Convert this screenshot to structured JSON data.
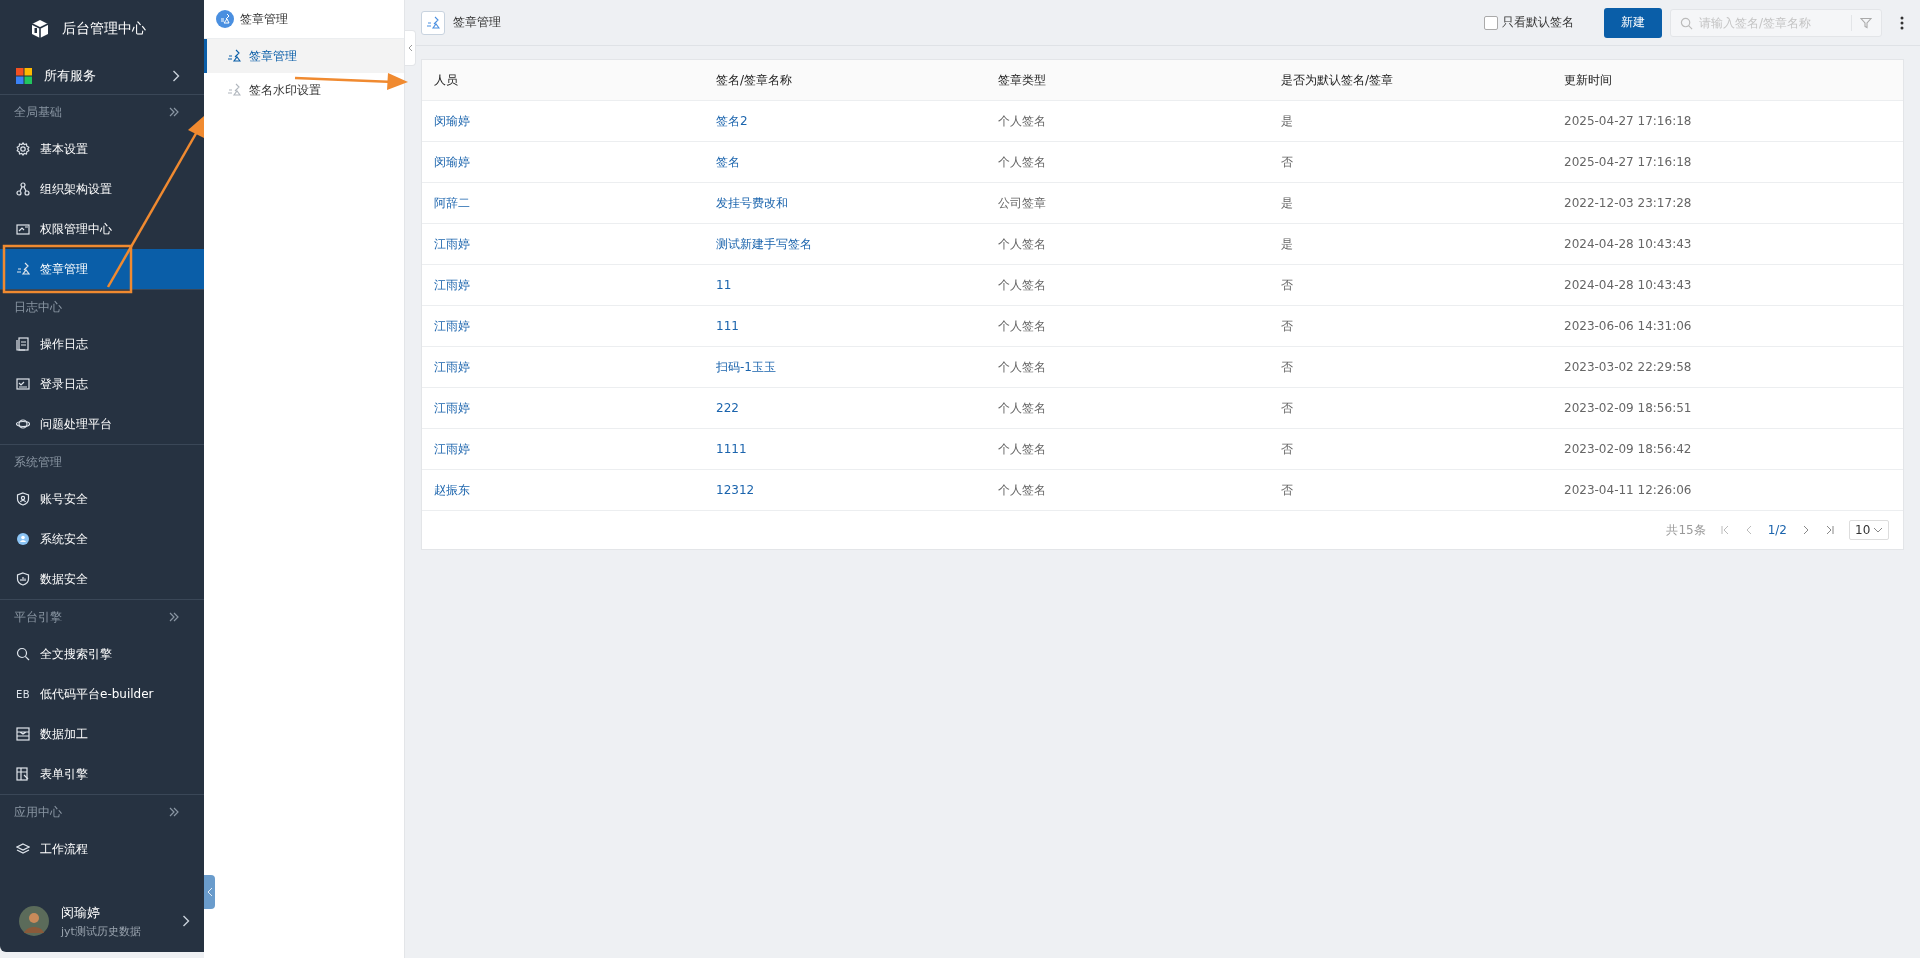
{
  "sidebar": {
    "title": "后台管理中心",
    "all_services": "所有服务",
    "groups": [
      {
        "label": "全局基础",
        "more": true,
        "items": [
          {
            "label": "基本设置",
            "selected": false
          },
          {
            "label": "组织架构设置",
            "selected": false
          },
          {
            "label": "权限管理中心",
            "selected": false
          },
          {
            "label": "签章管理",
            "selected": true
          }
        ]
      },
      {
        "label": "日志中心",
        "more": false,
        "items": [
          {
            "label": "操作日志",
            "selected": false
          },
          {
            "label": "登录日志",
            "selected": false
          },
          {
            "label": "问题处理平台",
            "selected": false
          }
        ]
      },
      {
        "label": "系统管理",
        "more": false,
        "items": [
          {
            "label": "账号安全",
            "selected": false
          },
          {
            "label": "系统安全",
            "selected": false
          },
          {
            "label": "数据安全",
            "selected": false
          }
        ]
      },
      {
        "label": "平台引擎",
        "more": true,
        "items": [
          {
            "label": "全文搜索引擎",
            "selected": false
          },
          {
            "label": "低代码平台e-builder",
            "selected": false,
            "badge": "EB"
          },
          {
            "label": "数据加工",
            "selected": false
          },
          {
            "label": "表单引擎",
            "selected": false
          }
        ]
      },
      {
        "label": "应用中心",
        "more": true,
        "items": [
          {
            "label": "工作流程",
            "selected": false
          }
        ]
      }
    ],
    "user": {
      "name": "闵瑜婷",
      "subtitle": "jyt测试历史数据"
    }
  },
  "subnav": {
    "title": "签章管理",
    "items": [
      {
        "label": "签章管理",
        "selected": true
      },
      {
        "label": "签名水印设置",
        "selected": false
      }
    ]
  },
  "header": {
    "title": "签章管理",
    "default_only": {
      "label": "只看默认签名",
      "checked": false
    },
    "new_button": "新建",
    "search": {
      "placeholder": "请输入签名/签章名称"
    }
  },
  "table": {
    "columns": [
      "人员",
      "签名/签章名称",
      "签章类型",
      "是否为默认签名/签章",
      "更新时间"
    ],
    "rows": [
      [
        "闵瑜婷",
        "签名2",
        "个人签名",
        "是",
        "2025-04-27 17:16:18"
      ],
      [
        "闵瑜婷",
        "签名",
        "个人签名",
        "否",
        "2025-04-27 17:16:18"
      ],
      [
        "阿辞二",
        "发挂号费改和",
        "公司签章",
        "是",
        "2022-12-03 23:17:28"
      ],
      [
        "江雨婷",
        "测试新建手写签名",
        "个人签名",
        "是",
        "2024-04-28 10:43:43"
      ],
      [
        "江雨婷",
        "11",
        "个人签名",
        "否",
        "2024-04-28 10:43:43"
      ],
      [
        "江雨婷",
        "111",
        "个人签名",
        "否",
        "2023-06-06 14:31:06"
      ],
      [
        "江雨婷",
        "扫码-1玉玉",
        "个人签名",
        "否",
        "2023-03-02 22:29:58"
      ],
      [
        "江雨婷",
        "222",
        "个人签名",
        "否",
        "2023-02-09 18:56:51"
      ],
      [
        "江雨婷",
        "1111",
        "个人签名",
        "否",
        "2023-02-09 18:56:42"
      ],
      [
        "赵振东",
        "12312",
        "个人签名",
        "否",
        "2023-04-11 12:26:06"
      ]
    ]
  },
  "pagination": {
    "total": "共15条",
    "page": "1/2",
    "page_size": "10"
  }
}
